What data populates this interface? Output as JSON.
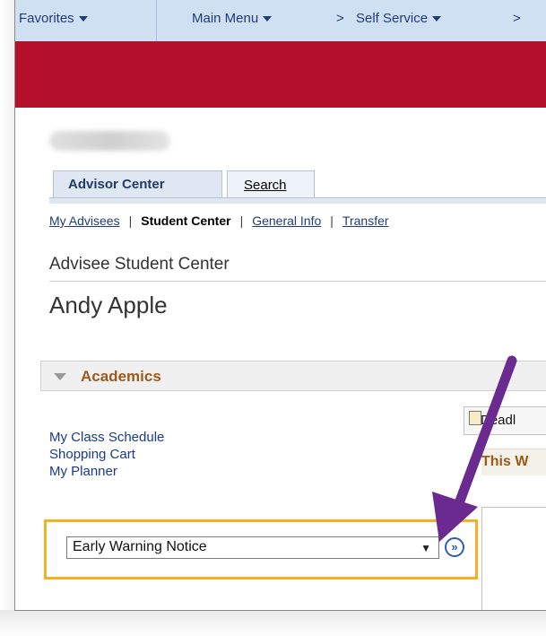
{
  "topnav": {
    "favorites": "Favorites",
    "main_menu": "Main Menu",
    "breadcrumb_sep": ">",
    "self_service": "Self Service",
    "breadcrumb_sep2": ">"
  },
  "tabs": {
    "advisor_center": "Advisor Center",
    "search": "Search"
  },
  "subnav": {
    "my_advisees": "My Advisees",
    "student_center": "Student Center",
    "general_info": "General Info",
    "transfer": "Transfer",
    "pipe": "|"
  },
  "page_label": "Advisee Student Center",
  "student_name": "Andy Apple",
  "academics": {
    "title": "Academics",
    "links": [
      "My Class Schedule",
      "Shopping Cart",
      "My Planner"
    ],
    "select_value": "Early Warning Notice",
    "select_arrow": "▼",
    "go_icon": "»"
  },
  "deadlines": {
    "label": "Deadl",
    "this_week": "This W"
  },
  "colors": {
    "banner": "#b5102b",
    "highlight": "#f5b026",
    "arrow": "#6b2a8f"
  }
}
